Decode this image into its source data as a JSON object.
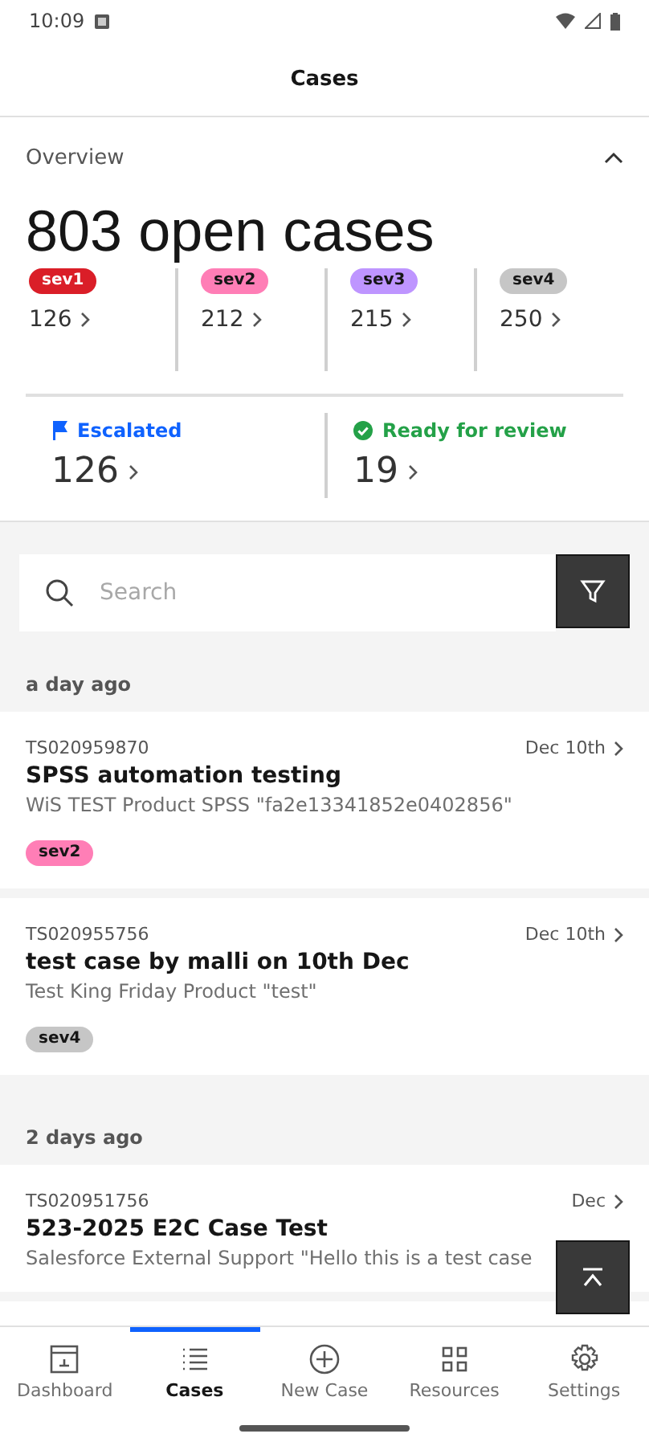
{
  "status_bar": {
    "time": "10:09"
  },
  "app_bar": {
    "title": "Cases"
  },
  "overview": {
    "title": "Overview",
    "expanded": true,
    "headline_number": "803",
    "headline_text": "open cases",
    "severities": [
      {
        "label": "sev1",
        "count": "126",
        "color": "#da1e28"
      },
      {
        "label": "sev2",
        "count": "212",
        "color": "#ff7eb6"
      },
      {
        "label": "sev3",
        "count": "215",
        "color": "#be95ff"
      },
      {
        "label": "sev4",
        "count": "250",
        "color": "#c6c6c6"
      }
    ],
    "stats": [
      {
        "kind": "escalated",
        "label": "Escalated",
        "count": "126"
      },
      {
        "kind": "ready",
        "label": "Ready for review",
        "count": "19"
      }
    ]
  },
  "search": {
    "placeholder": "Search"
  },
  "groups": [
    {
      "label": "a day ago",
      "cases": [
        {
          "id": "TS020959870",
          "date": "Dec 10th",
          "title": "SPSS automation testing",
          "description": "WiS TEST Product SPSS \"fa2e13341852e0402856\"",
          "severity": {
            "label": "sev2",
            "color": "#ff7eb6"
          }
        },
        {
          "id": "TS020955756",
          "date": "Dec 10th",
          "title": "test case by malli on 10th Dec",
          "description": "Test King Friday Product \"test\"",
          "severity": {
            "label": "sev4",
            "color": "#c6c6c6"
          }
        }
      ]
    },
    {
      "label": "2 days ago",
      "cases": [
        {
          "id": "TS020951756",
          "date": "Dec",
          "title": "523-2025 E2C Case Test",
          "description": "Salesforce External Support \"Hello this is a test case"
        }
      ]
    }
  ],
  "bottom_nav": [
    {
      "kind": "dashboard",
      "label": "Dashboard",
      "selected": false
    },
    {
      "kind": "cases",
      "label": "Cases",
      "selected": true
    },
    {
      "kind": "new",
      "label": "New Case",
      "selected": false
    },
    {
      "kind": "resources",
      "label": "Resources",
      "selected": false
    },
    {
      "kind": "settings",
      "label": "Settings",
      "selected": false
    }
  ]
}
